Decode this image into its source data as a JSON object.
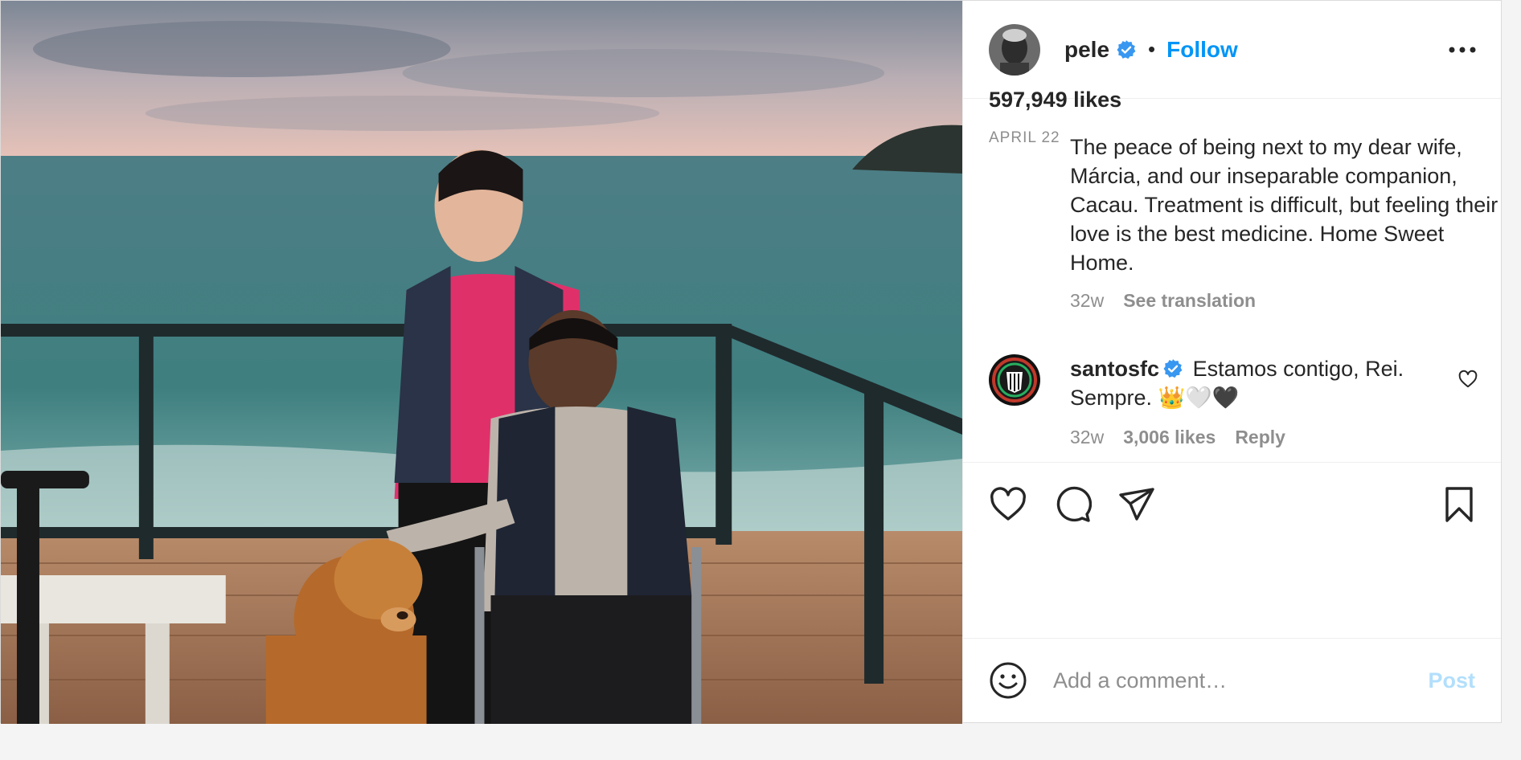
{
  "header": {
    "username": "pele",
    "separator": "•",
    "follow_label": "Follow",
    "avatar_icon": "pele-avatar",
    "verified_icon": "verified-badge-icon",
    "more_icon": "more-options-icon"
  },
  "caption": {
    "text": "The peace of being next to my dear wife, Márcia, and our inseparable companion, Cacau. Treatment is difficult, but feeling their love is the best medicine. Home Sweet Home.",
    "time": "32w",
    "see_translation": "See translation"
  },
  "comments": [
    {
      "username": "santosfc",
      "text": "Estamos contigo, Rei. Sempre. 👑🤍🖤",
      "time": "32w",
      "likes": "3,006 likes",
      "reply": "Reply"
    }
  ],
  "actions": {
    "like_icon": "heart-icon",
    "comment_icon": "comment-icon",
    "share_icon": "share-icon",
    "save_icon": "bookmark-icon"
  },
  "stats": {
    "likes": "597,949 likes",
    "date": "APRIL 22"
  },
  "add_comment": {
    "placeholder": "Add a comment…",
    "post_label": "Post",
    "emoji_icon": "emoji-icon"
  },
  "colors": {
    "accent": "#0095f6",
    "muted": "#8e8e8e",
    "post_disabled": "#b2dffc",
    "text": "#262626"
  }
}
